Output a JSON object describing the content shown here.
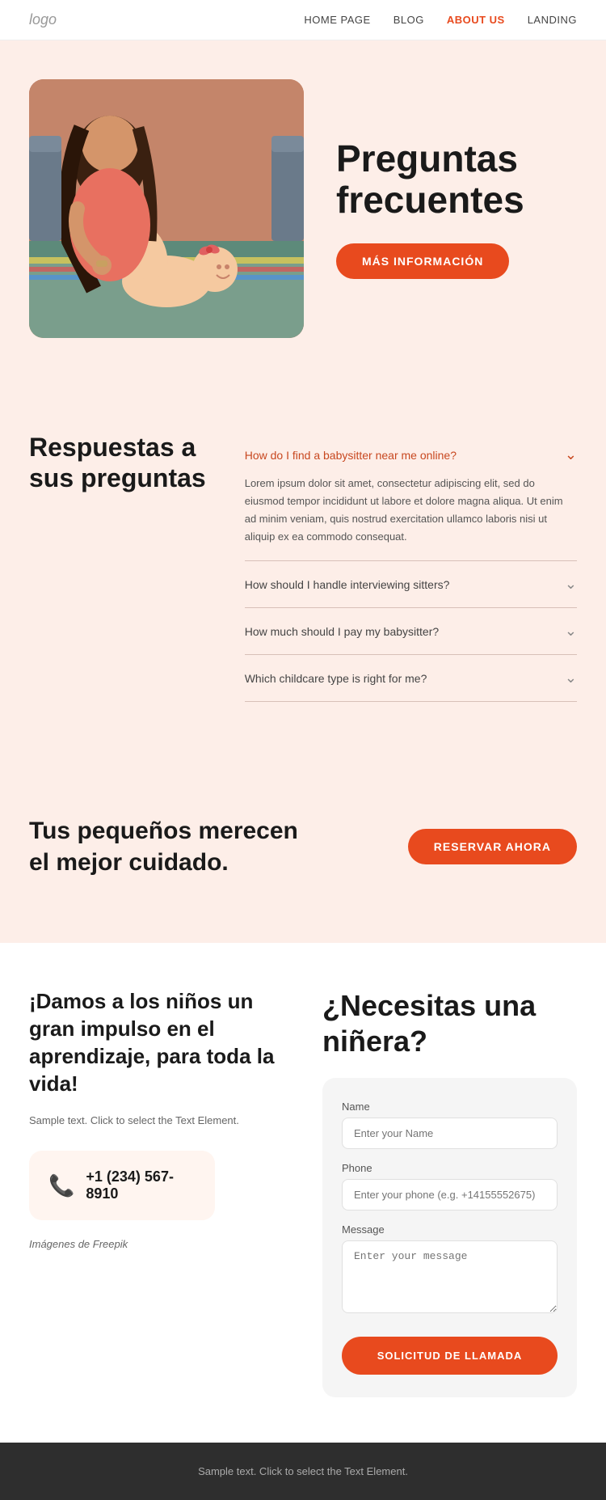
{
  "nav": {
    "logo": "logo",
    "links": [
      {
        "label": "HOME PAGE",
        "active": false
      },
      {
        "label": "BLOG",
        "active": false
      },
      {
        "label": "ABOUT US",
        "active": true
      },
      {
        "label": "LANDING",
        "active": false
      }
    ]
  },
  "hero": {
    "heading_line1": "Preguntas",
    "heading_line2": "frecuentes",
    "button_label": "MÁS INFORMACIÓN"
  },
  "faq_section": {
    "heading_line1": "Respuestas a",
    "heading_line2": "sus preguntas",
    "items": [
      {
        "question": "How do I find a babysitter near me online?",
        "open": true,
        "answer": "Lorem ipsum dolor sit amet, consectetur adipiscing elit, sed do eiusmod tempor incididunt ut labore et dolore magna aliqua. Ut enim ad minim veniam, quis nostrud exercitation ullamco laboris nisi ut aliquip ex ea commodo consequat.",
        "accent": true
      },
      {
        "question": "How should I handle interviewing sitters?",
        "open": false,
        "answer": "",
        "accent": false
      },
      {
        "question": "How much should I pay my babysitter?",
        "open": false,
        "answer": "",
        "accent": false
      },
      {
        "question": "Which childcare type is right for me?",
        "open": false,
        "answer": "",
        "accent": false
      }
    ]
  },
  "cta": {
    "heading": "Tus pequeños merecen el mejor cuidado.",
    "button_label": "RESERVAR AHORA"
  },
  "contact": {
    "left_heading": "¡Damos a los niños un gran impulso en el aprendizaje, para toda la vida!",
    "left_text": "Sample text. Click to select the Text Element.",
    "phone": "+1 (234) 567-8910",
    "credit": "Imágenes de Freepik",
    "right_heading_line1": "¿Necesitas una",
    "right_heading_line2": "niñera?",
    "form": {
      "name_label": "Name",
      "name_placeholder": "Enter your Name",
      "phone_label": "Phone",
      "phone_placeholder": "Enter your phone (e.g. +14155552675)",
      "message_label": "Message",
      "message_placeholder": "Enter your message",
      "submit_label": "SOLICITUD DE LLAMADA"
    }
  },
  "footer": {
    "text": "Sample text. Click to select the Text Element."
  }
}
